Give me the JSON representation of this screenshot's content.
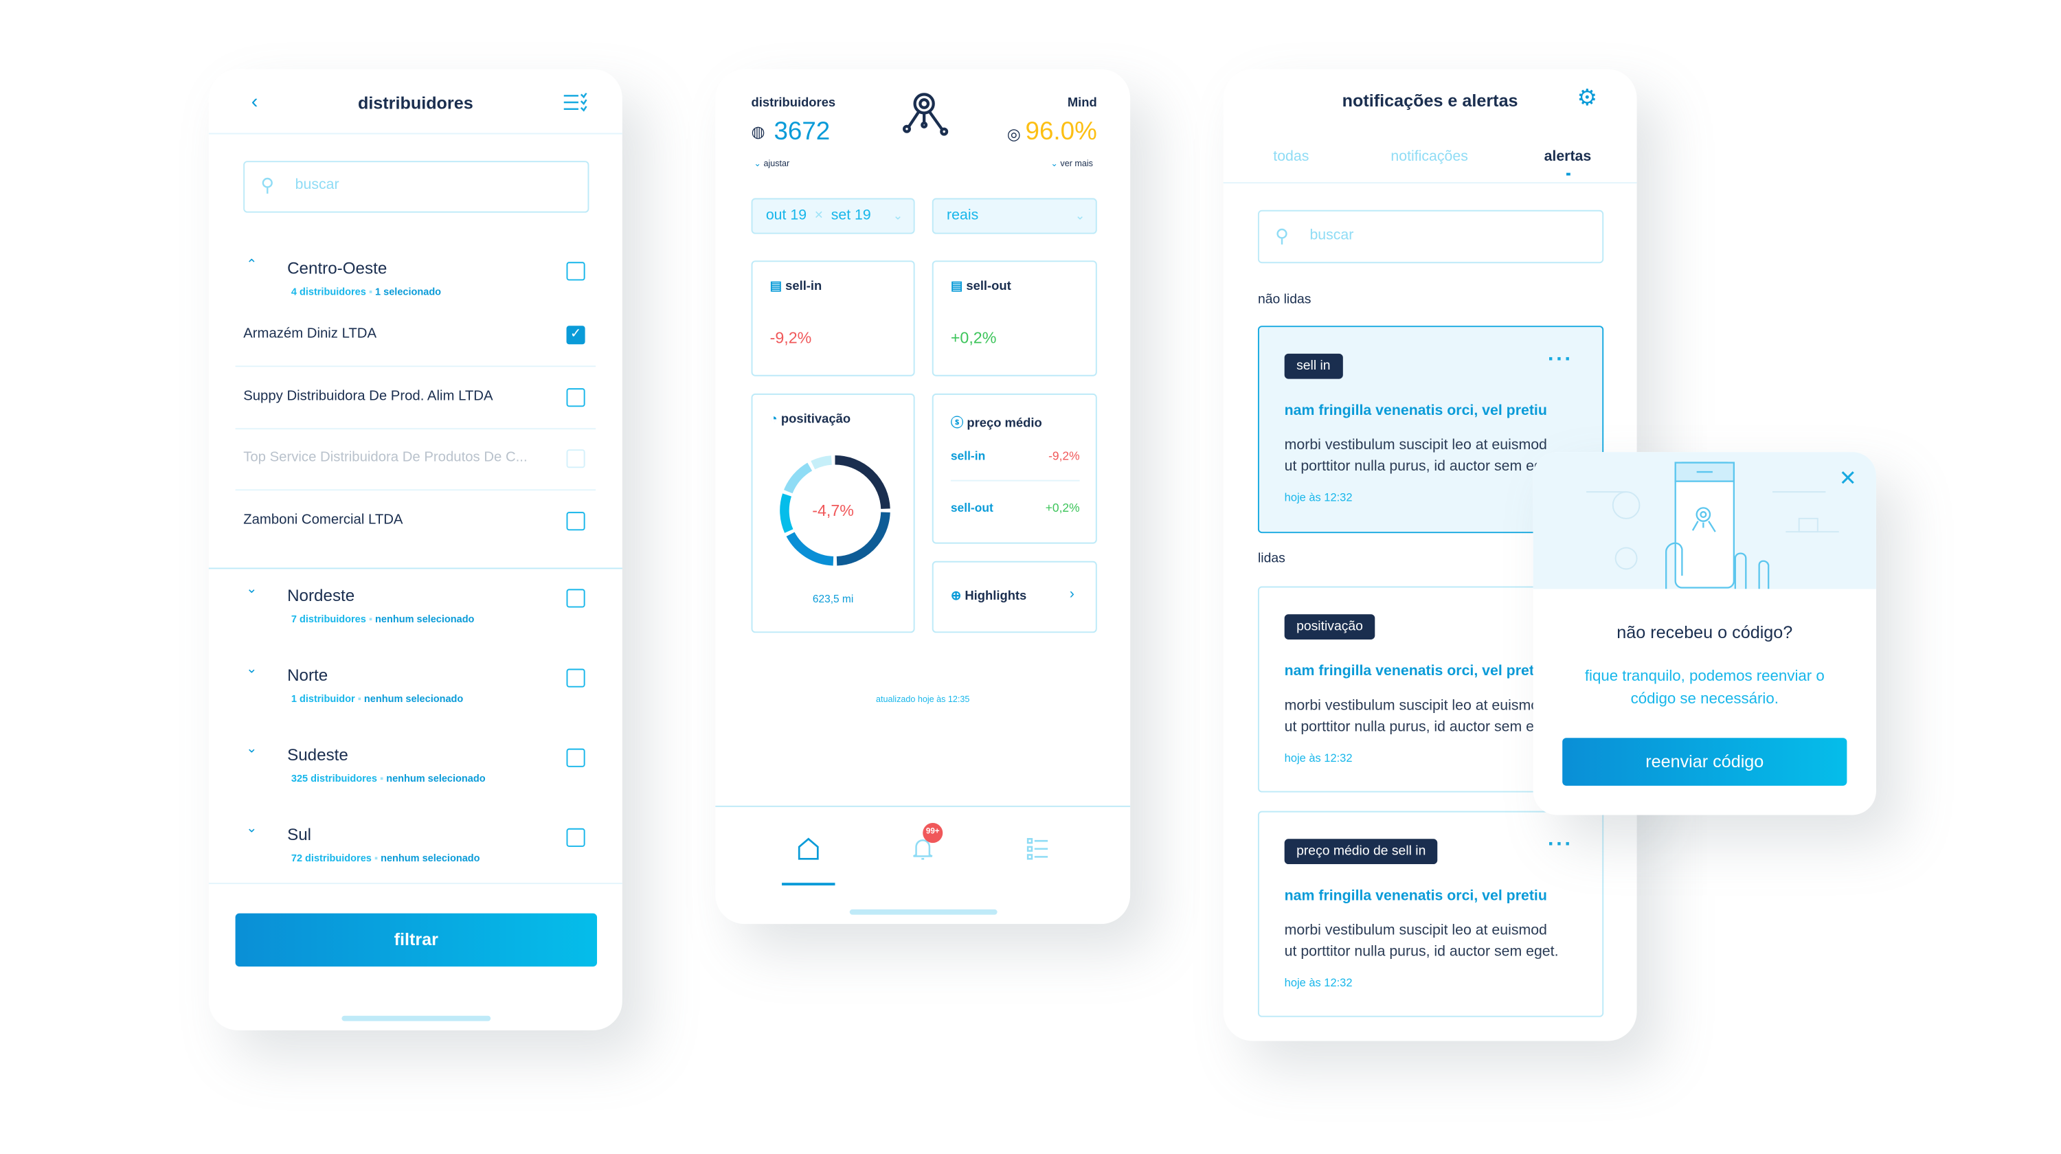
{
  "distributors_screen": {
    "title": "distribuidores",
    "search_placeholder": "buscar",
    "regions": [
      {
        "name": "Centro-Oeste",
        "count": "4 distribuidores",
        "selection": "1 selecionado",
        "expanded": true,
        "checked": false,
        "items": [
          {
            "name": "Armazém Diniz LTDA",
            "checked": true,
            "disabled": false
          },
          {
            "name": "Suppy Distribuidora De Prod. Alim LTDA",
            "checked": false,
            "disabled": false
          },
          {
            "name": "Top Service Distribuidora De Produtos De C...",
            "checked": false,
            "disabled": true
          },
          {
            "name": "Zamboni Comercial LTDA",
            "checked": false,
            "disabled": false
          }
        ]
      },
      {
        "name": "Nordeste",
        "count": "7 distribuidores",
        "selection": "nenhum selecionado",
        "expanded": false,
        "checked": false
      },
      {
        "name": "Norte",
        "count": "1 distribuidor",
        "selection": "nenhum selecionado",
        "expanded": false,
        "checked": false
      },
      {
        "name": "Sudeste",
        "count": "325 distribuidores",
        "selection": "nenhum selecionado",
        "expanded": false,
        "checked": false
      },
      {
        "name": "Sul",
        "count": "72 distribuidores",
        "selection": "nenhum selecionado",
        "expanded": false,
        "checked": false
      }
    ],
    "filter_button": "filtrar"
  },
  "dashboard": {
    "distributors_label": "distribuidores",
    "distributors_value": "3672",
    "adjust": "ajustar",
    "mind_label": "Mind",
    "mind_value": "96.0%",
    "see_more": "ver mais",
    "period_from": "out 19",
    "period_to": "set 19",
    "currency": "reais",
    "sell_in": {
      "label": "sell-in",
      "value": "-9,2%"
    },
    "sell_out": {
      "label": "sell-out",
      "value": "+0,2%"
    },
    "positivation": {
      "label": "positivação",
      "value": "-4,7%",
      "total": "623,5 mi"
    },
    "avg_price": {
      "label": "preço médio",
      "sell_in_label": "sell-in",
      "sell_in_value": "-9,2%",
      "sell_out_label": "sell-out",
      "sell_out_value": "+0,2%"
    },
    "highlights": "Highlights",
    "updated": "atualizado hoje às 12:35",
    "badge": "99+",
    "colors": {
      "accent": "#0a9bd8",
      "warning": "#fcbf14",
      "negative": "#f0585a",
      "positive": "#3cc45a",
      "navy": "#1a2e4f"
    }
  },
  "notifications": {
    "title": "notificações e alertas",
    "tabs": [
      "todas",
      "notificações",
      "alertas"
    ],
    "active_tab": "alertas",
    "search_placeholder": "buscar",
    "unread_label": "não lidas",
    "read_label": "lidas",
    "cards": [
      {
        "tag": "sell in",
        "title": "nam fringilla venenatis orci, vel pretiu",
        "body1": "morbi vestibulum suscipit leo at euismod",
        "body2": "ut porttitor nulla purus, id auctor sem eget.",
        "time": "hoje às 12:32"
      },
      {
        "tag": "positivação",
        "title": "nam fringilla venenatis orci, vel pretiu",
        "body1": "morbi vestibulum suscipit leo at euismod",
        "body2": "ut porttitor nulla purus, id auctor sem eget.",
        "time": "hoje às 12:32"
      },
      {
        "tag": "preço médio de sell in",
        "title": "nam fringilla venenatis orci, vel pretiu",
        "body1": "morbi vestibulum suscipit leo at euismod",
        "body2": "ut porttitor nulla purus, id auctor sem eget.",
        "time": "hoje às 12:32"
      }
    ]
  },
  "modal": {
    "title": "não recebeu o código?",
    "text1": "fique tranquilo, podemos reenviar o",
    "text2": "código se necessário.",
    "button": "reenviar código"
  }
}
